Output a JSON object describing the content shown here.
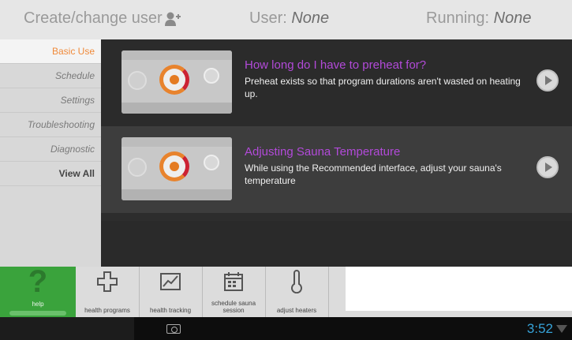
{
  "header": {
    "create_label": "Create/change user",
    "user_label": "User:",
    "user_value": "None",
    "running_label": "Running:",
    "running_value": "None"
  },
  "sidebar": {
    "items": [
      {
        "label": "Basic Use"
      },
      {
        "label": "Schedule"
      },
      {
        "label": "Settings"
      },
      {
        "label": "Troubleshooting"
      },
      {
        "label": "Diagnostic"
      },
      {
        "label": "View All"
      }
    ]
  },
  "cards": [
    {
      "title": "How long do I have to preheat for?",
      "description": "Preheat exists so that program durations aren't wasted on heating up."
    },
    {
      "title": "Adjusting Sauna Temperature",
      "description": "While using the Recommended interface, adjust your sauna's temperature"
    }
  ],
  "toolbar": {
    "help": "help",
    "health_programs": "health programs",
    "health_tracking": "health tracking",
    "schedule_session": "schedule sauna session",
    "adjust_heaters": "adjust heaters"
  },
  "status": {
    "time": "3:52"
  },
  "colors": {
    "accent_orange": "#f08a3a",
    "title_purple": "#b24ad9",
    "help_green": "#3aa33c",
    "time_blue": "#36a3d9"
  },
  "icons": [
    "add-user-icon",
    "play-icon",
    "help-icon",
    "health-programs-icon",
    "health-tracking-icon",
    "schedule-icon",
    "thermometer-icon",
    "screenshot-icon",
    "wifi-icon"
  ]
}
